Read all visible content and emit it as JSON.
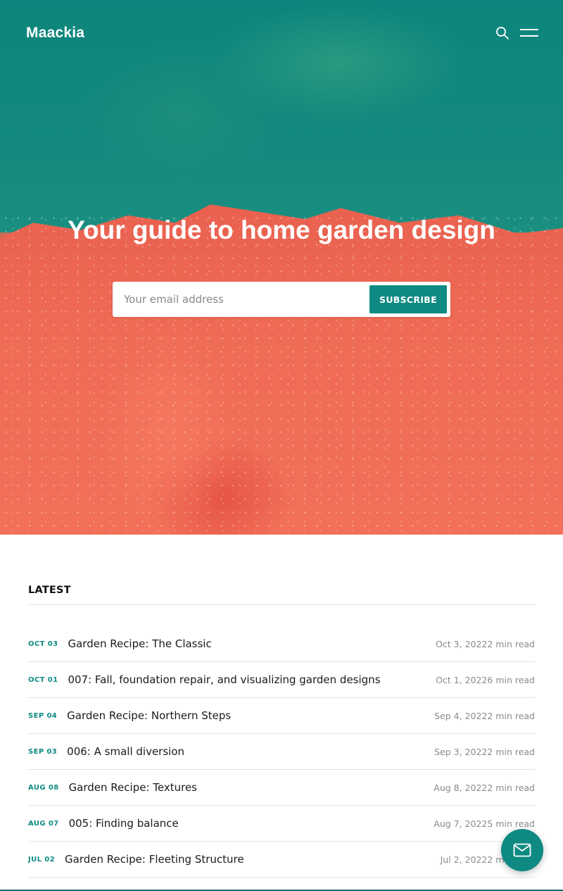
{
  "header": {
    "logo": "Maackia",
    "search_icon": "search-icon",
    "menu_icon": "hamburger-menu-icon"
  },
  "hero": {
    "title": "Your guide to home garden design",
    "email_placeholder": "Your email address",
    "subscribe_label": "SUBSCRIBE"
  },
  "latest": {
    "heading": "LATEST",
    "posts": [
      {
        "date": "OCT 03",
        "title": "Garden Recipe: The Classic",
        "meta": "Oct 3, 20222 min read"
      },
      {
        "date": "OCT 01",
        "title": "007: Fall, foundation repair, and visualizing garden designs",
        "meta": "Oct 1, 20226 min read"
      },
      {
        "date": "SEP 04",
        "title": "Garden Recipe: Northern Steps",
        "meta": "Sep 4, 20222 min read"
      },
      {
        "date": "SEP 03",
        "title": "006: A small diversion",
        "meta": "Sep 3, 20222 min read"
      },
      {
        "date": "AUG 08",
        "title": "Garden Recipe: Textures",
        "meta": "Aug 8, 20222 min read"
      },
      {
        "date": "AUG 07",
        "title": "005: Finding balance",
        "meta": "Aug 7, 20225 min read"
      },
      {
        "date": "JUL 02",
        "title": "Garden Recipe: Fleeting Structure",
        "meta": "Jul 2, 20222 min read"
      }
    ]
  },
  "fab": {
    "icon": "mail-icon"
  },
  "colors": {
    "accent": "#0e8a82",
    "hero_green": "#0f8a80",
    "hero_coral": "#ee6a54"
  }
}
